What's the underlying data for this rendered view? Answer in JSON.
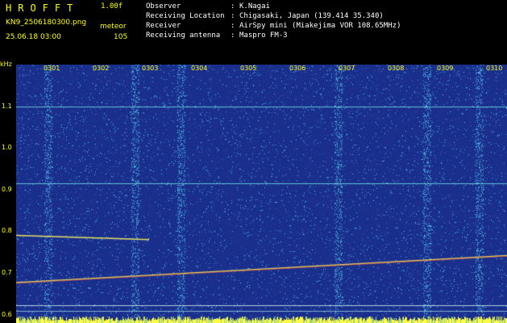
{
  "header": {
    "app_title": "HROFFT",
    "version": "1.00f",
    "filename": "KN9_2506180300.png",
    "mode_label": "meteor",
    "datetime": "25.06.18 03:00",
    "count": "105",
    "info": [
      {
        "label": "Observer",
        "sep": ":",
        "value": "K.Nagai"
      },
      {
        "label": "Receiving Location",
        "sep": ":",
        "value": "Chigasaki, Japan (139.414 35.340)"
      },
      {
        "label": "Receiver",
        "sep": ":",
        "value": "AirSpy mini (Miakejima VOR 108.65MHz)"
      },
      {
        "label": "Receiving antenna",
        "sep": ":",
        "value": "Maspro FM-3"
      }
    ]
  },
  "spectrogram": {
    "freq_unit": "kHz",
    "freq_labels": [
      "1.1",
      "1.0",
      "0.9",
      "0.8",
      "0.7",
      "0.6"
    ],
    "freq_values": [
      1.1,
      1.0,
      0.9,
      0.8,
      0.7,
      0.6
    ],
    "freq_range": [
      0.58,
      1.2
    ],
    "time_labels": [
      "0301",
      "0302",
      "0303",
      "0304",
      "0305",
      "0306",
      "0307",
      "0308",
      "0309",
      "0310"
    ],
    "colors": {
      "background": "#1a2f8c",
      "noise": "#2fa0d8",
      "trace": "#e8e060",
      "label": "#ffff00"
    }
  }
}
